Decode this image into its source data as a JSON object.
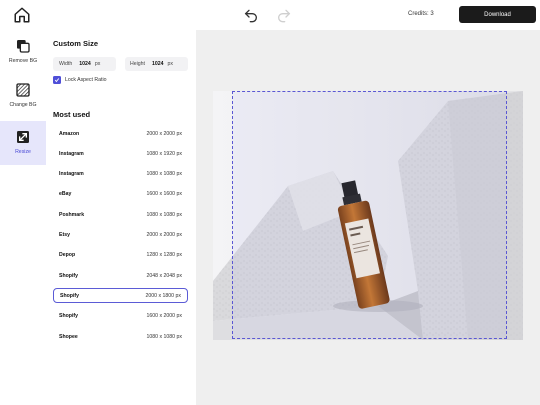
{
  "header": {
    "credits": "Credits: 3",
    "download_label": "Download"
  },
  "tools": [
    {
      "label": "Remove BG",
      "icon": "layers-icon",
      "active": false
    },
    {
      "label": "Change BG",
      "icon": "hatched-square-icon",
      "active": false
    },
    {
      "label": "Resize",
      "icon": "resize-icon",
      "active": true
    }
  ],
  "custom_size": {
    "title": "Custom Size",
    "width_label": "Width",
    "width_value": "1024",
    "width_unit": "px",
    "height_label": "Height",
    "height_value": "1024",
    "height_unit": "px",
    "lock_label": "Lock Aspect Ratio",
    "lock_checked": true
  },
  "most_used": {
    "title": "Most used",
    "presets": [
      {
        "name": "Amazon",
        "size": "2000 x 2000 px"
      },
      {
        "name": "Instagram",
        "size": "1080 x 1920 px"
      },
      {
        "name": "Instagram",
        "size": "1080 x 1080 px"
      },
      {
        "name": "eBay",
        "size": "1600 x 1600 px"
      },
      {
        "name": "Poshmark",
        "size": "1080 x 1080 px"
      },
      {
        "name": "Etsy",
        "size": "2000 x 2000 px"
      },
      {
        "name": "Depop",
        "size": "1280 x 1280 px"
      },
      {
        "name": "Shopify",
        "size": "2048 x 2048 px"
      },
      {
        "name": "Shopify",
        "size": "2000 x 1800 px",
        "selected": true
      },
      {
        "name": "Shopify",
        "size": "1600 x 2000 px"
      },
      {
        "name": "Shopee",
        "size": "1080 x 1080 px"
      }
    ]
  },
  "colors": {
    "accent": "#5b5bd6",
    "download_bg": "#1b1b1b",
    "canvas_bg": "#efefef"
  }
}
